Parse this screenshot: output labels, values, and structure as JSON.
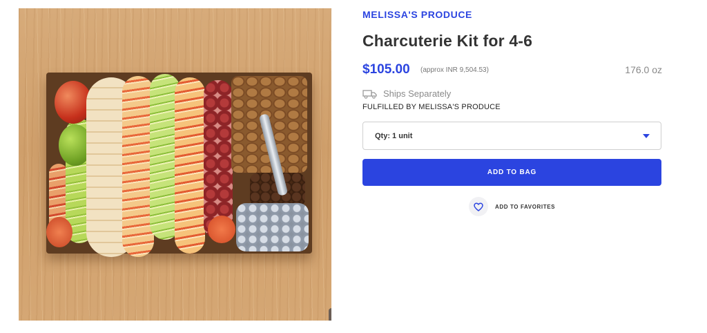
{
  "product": {
    "brand": "MELISSA'S PRODUCE",
    "title": "Charcuterie Kit for 4-6",
    "price": "$105.00",
    "approx_price": "(approx INR 9,504.53)",
    "weight": "176.0 oz",
    "shipping_note": "Ships Separately",
    "fulfilled_by": "FULFILLED BY MELISSA'S PRODUCE"
  },
  "quantity": {
    "selected": "Qty: 1 unit"
  },
  "actions": {
    "add_to_bag": "ADD TO BAG",
    "add_to_favorites": "ADD TO FAVORITES"
  },
  "icons": {
    "zoom": "magnifier-icon",
    "shipping": "truck-icon",
    "favorite": "heart-outline-icon",
    "dropdown": "caret-down-icon"
  },
  "colors": {
    "accent": "#2b44e0"
  }
}
